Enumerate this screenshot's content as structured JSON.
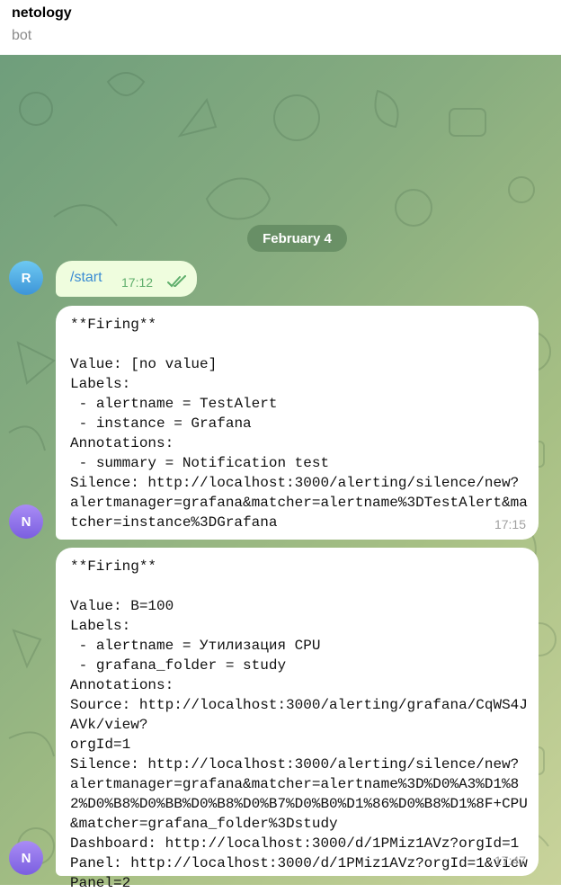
{
  "header": {
    "title": "netology",
    "status": "bot"
  },
  "date_separator": "February 4",
  "avatars": {
    "user": "R",
    "bot": "N"
  },
  "outgoing": {
    "text": "/start",
    "time": "17:12",
    "read_icon": "double-check-icon"
  },
  "messages": [
    {
      "text": "**Firing**\n\nValue: [no value]\nLabels:\n - alertname = TestAlert\n - instance = Grafana\nAnnotations:\n - summary = Notification test\nSilence: http://localhost:3000/alerting/silence/new?\nalertmanager=grafana&matcher=alertname%3DTestAlert&matcher=instance%3DGrafana",
      "time": "17:15"
    },
    {
      "text": "**Firing**\n\nValue: B=100\nLabels:\n - alertname = Утилизация CPU\n - grafana_folder = study\nAnnotations:\nSource: http://localhost:3000/alerting/grafana/CqWS4JAVk/view?\norgId=1\nSilence: http://localhost:3000/alerting/silence/new?\nalertmanager=grafana&matcher=alertname%3D%D0%A3%D1%82%D0%B8%D0%BB%D0%B8%D0%B7%D0%B0%D1%86%D0%B8%D1%8F+CPU&matcher=grafana_folder%3Dstudy\nDashboard: http://localhost:3000/d/1PMiz1AVz?orgId=1\nPanel: http://localhost:3000/d/1PMiz1AVz?orgId=1&viewPanel=2",
      "time": "17:47"
    }
  ],
  "colors": {
    "outgoing_bubble": "#effdde",
    "link": "#3a8bd3",
    "read_check": "#5fae6c",
    "user_avatar": "#4aa7e4",
    "bot_avatar": "#8e72ea"
  }
}
